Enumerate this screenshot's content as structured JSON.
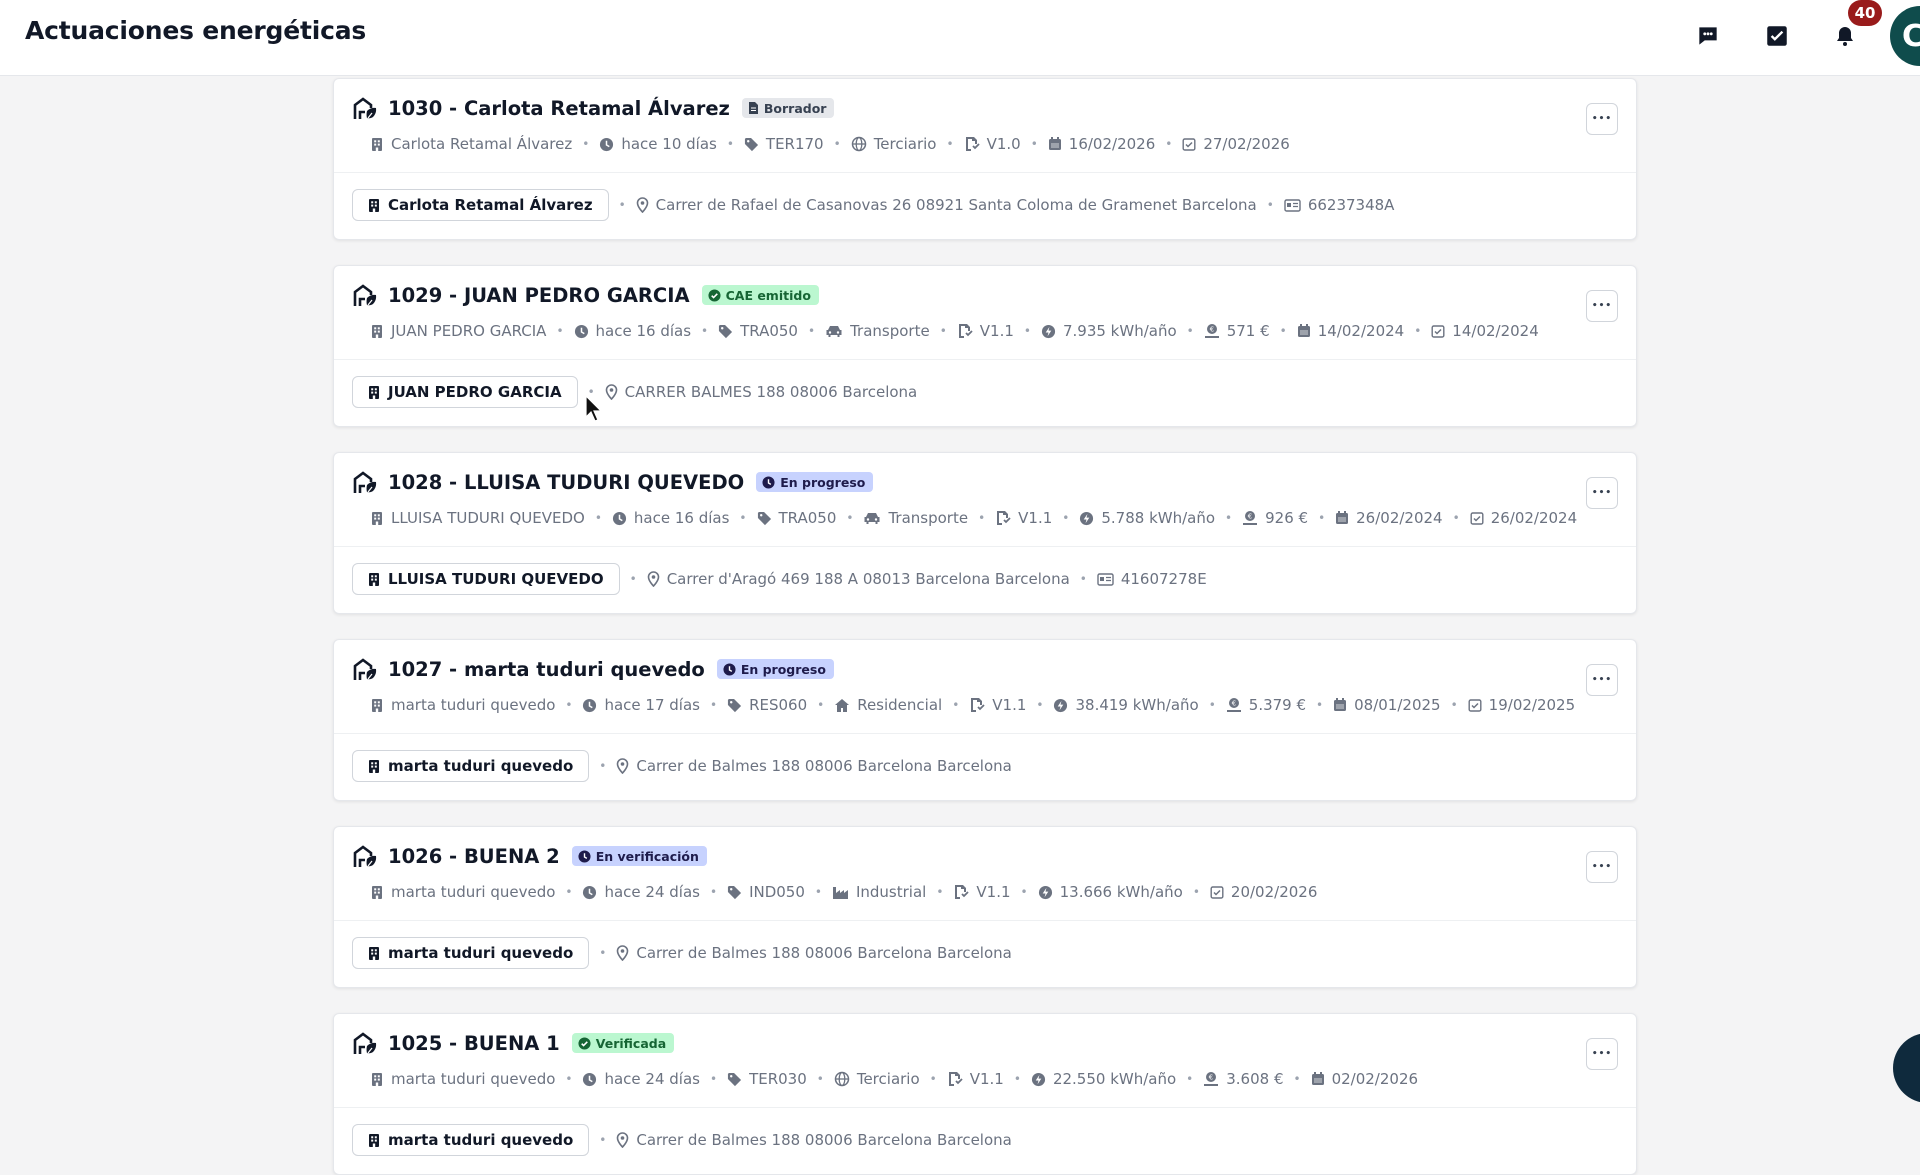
{
  "header": {
    "title": "Actuaciones energéticas",
    "notification_count": "40",
    "avatar_initial": "C",
    "icons": [
      "chat-icon",
      "task-check-icon",
      "bell-icon"
    ]
  },
  "colors": {
    "draft_bg": "#e5e7eb",
    "draft_fg": "#374151",
    "success_bg": "#bbf7d0",
    "success_fg": "#166534",
    "progress_bg": "#c7d2fe",
    "progress_fg": "#1e1b4b"
  },
  "cards": [
    {
      "title": "1030 - Carlota Retamal Álvarez",
      "status": "Borrador",
      "status_type": "draft",
      "meta": {
        "client": "Carlota Retamal Álvarez",
        "time": "hace 10 días",
        "code": "TER170",
        "sector": "Terciario",
        "sector_icon": "globe-icon",
        "version": "V1.0",
        "date_start": "16/02/2026",
        "date_end": "27/02/2026"
      },
      "footer": {
        "client": "Carlota Retamal Álvarez",
        "address": "Carrer de Rafael de Casanovas 26 08921 Santa Coloma de Gramenet Barcelona",
        "id": "66237348A"
      }
    },
    {
      "title": "1029 - JUAN PEDRO GARCIA",
      "status": "CAE emitido",
      "status_type": "success",
      "meta": {
        "client": "JUAN PEDRO GARCIA",
        "time": "hace 16 días",
        "code": "TRA050",
        "sector": "Transporte",
        "sector_icon": "car-icon",
        "version": "V1.1",
        "energy": "7.935 kWh/año",
        "amount": "571 €",
        "date_start": "14/02/2024",
        "date_end": "14/02/2024"
      },
      "footer": {
        "client": "JUAN PEDRO GARCIA",
        "address": "CARRER BALMES 188 08006 Barcelona"
      }
    },
    {
      "title": "1028 - LLUISA TUDURI QUEVEDO",
      "status": "En progreso",
      "status_type": "progress",
      "meta": {
        "client": "LLUISA TUDURI QUEVEDO",
        "time": "hace 16 días",
        "code": "TRA050",
        "sector": "Transporte",
        "sector_icon": "car-icon",
        "version": "V1.1",
        "energy": "5.788 kWh/año",
        "amount": "926 €",
        "date_start": "26/02/2024",
        "date_end": "26/02/2024"
      },
      "footer": {
        "client": "LLUISA TUDURI QUEVEDO",
        "address": "Carrer d'Aragó 469 188 A 08013 Barcelona Barcelona",
        "id": "41607278E"
      }
    },
    {
      "title": "1027 - marta tuduri quevedo",
      "status": "En progreso",
      "status_type": "progress",
      "meta": {
        "client": "marta tuduri quevedo",
        "time": "hace 17 días",
        "code": "RES060",
        "sector": "Residencial",
        "sector_icon": "home-icon",
        "version": "V1.1",
        "energy": "38.419 kWh/año",
        "amount": "5.379 €",
        "date_start": "08/01/2025",
        "date_end": "19/02/2025"
      },
      "footer": {
        "client": "marta tuduri quevedo",
        "address": "Carrer de Balmes 188 08006 Barcelona Barcelona"
      }
    },
    {
      "title": "1026 - BUENA 2",
      "status": "En verificación",
      "status_type": "progress",
      "meta": {
        "client": "marta tuduri quevedo",
        "time": "hace 24 días",
        "code": "IND050",
        "sector": "Industrial",
        "sector_icon": "factory-icon",
        "version": "V1.1",
        "energy": "13.666 kWh/año",
        "date_end": "20/02/2026"
      },
      "footer": {
        "client": "marta tuduri quevedo",
        "address": "Carrer de Balmes 188 08006 Barcelona Barcelona"
      }
    },
    {
      "title": "1025 - BUENA 1",
      "status": "Verificada",
      "status_type": "success",
      "meta": {
        "client": "marta tuduri quevedo",
        "time": "hace 24 días",
        "code": "TER030",
        "sector": "Terciario",
        "sector_icon": "globe-icon",
        "version": "V1.1",
        "energy": "22.550 kWh/año",
        "amount": "3.608 €",
        "date_start": "02/02/2026"
      },
      "footer": {
        "client": "marta tuduri quevedo",
        "address": "Carrer de Balmes 188 08006 Barcelona Barcelona"
      }
    }
  ]
}
